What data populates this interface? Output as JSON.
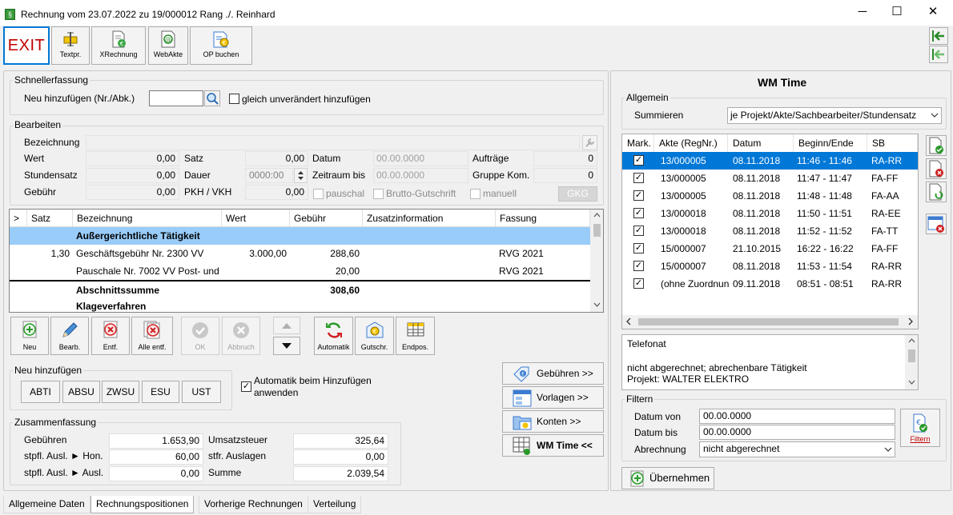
{
  "window": {
    "title": "Rechnung vom 23.07.2022 zu 19/000012  Rang ./. Reinhard",
    "minimize": "─",
    "maximize": "☐",
    "close": "✕"
  },
  "toolbar": {
    "exit": "EXIT",
    "textpr": "Textpr.",
    "xrechnung": "XRechnung",
    "webakte": "WebAkte",
    "op_buchen": "OP buchen"
  },
  "schnell": {
    "group": "Schnellerfassung",
    "label": "Neu hinzufügen (Nr./Abk.)",
    "value": "",
    "checkbox": "gleich unverändert hinzufügen"
  },
  "bearbeiten": {
    "group": "Bearbeiten",
    "bezeichnung_label": "Bezeichnung",
    "bezeichnung": "",
    "wert_label": "Wert",
    "wert": "0,00",
    "stundensatz_label": "Stundensatz",
    "stundensatz": "0,00",
    "gebuehr_label": "Gebühr",
    "gebuehr": "0,00",
    "satz_label": "Satz",
    "satz": "0,00",
    "dauer_label": "Dauer",
    "dauer": "0000:00",
    "pkh_label": "PKH / VKH",
    "pkh": "0,00",
    "datum_label": "Datum",
    "datum": "00.00.0000",
    "zeitraum_label": "Zeitraum bis",
    "zeitraum": "00.00.0000",
    "pauschal": "pauschal",
    "brutto": "Brutto-Gutschrift",
    "manuell": "manuell",
    "auftraege_label": "Aufträge",
    "auftraege": "0",
    "gruppe_label": "Gruppe Kom.",
    "gruppe": "0",
    "gkg": "GKG"
  },
  "table": {
    "headers": [
      ">",
      "Satz",
      "Bezeichnung",
      "Wert",
      "Gebühr",
      "Zusatzinformation",
      "Fassung"
    ],
    "rows": [
      {
        "satz": "",
        "bez": "Außergerichtliche Tätigkeit",
        "wert": "",
        "geb": "",
        "zusatz": "",
        "fassung": "",
        "bold": true,
        "selected": true
      },
      {
        "satz": "1,30",
        "bez": "Geschäftsgebühr Nr. 2300 VV",
        "wert": "3.000,00",
        "geb": "288,60",
        "zusatz": "",
        "fassung": "RVG 2021",
        "bold": false,
        "selected": false
      },
      {
        "satz": "",
        "bez": "Pauschale Nr. 7002 VV Post- und",
        "wert": "",
        "geb": "20,00",
        "zusatz": "",
        "fassung": "RVG 2021",
        "bold": false,
        "selected": false
      },
      {
        "satz": "",
        "bez": "Abschnittssumme",
        "wert": "",
        "geb": "308,60",
        "zusatz": "",
        "fassung": "",
        "bold": true,
        "selected": false
      },
      {
        "satz": "",
        "bez": "Klageverfahren",
        "wert": "",
        "geb": "",
        "zusatz": "",
        "fassung": "",
        "bold": true,
        "selected": false
      }
    ]
  },
  "actions": {
    "neu": "Neu",
    "bearb": "Bearb.",
    "entf": "Entf.",
    "alle_entf": "Alle entf.",
    "ok": "OK",
    "abbruch": "Abbruch",
    "automatik": "Automatik",
    "gutschr": "Gutschr.",
    "endpos": "Endpos."
  },
  "neu_hinzufuegen": {
    "group": "Neu hinzufügen",
    "buttons": [
      "ABTI",
      "ABSU",
      "ZWSU",
      "ESU",
      "UST"
    ],
    "auto": "Automatik beim Hinzufügen anwenden"
  },
  "side_buttons": {
    "gebuehren": "Gebühren >>",
    "vorlagen": "Vorlagen >>",
    "konten": "Konten >>",
    "wmtime": "WM Time <<"
  },
  "zusammenfassung": {
    "group": "Zusammenfassung",
    "gebuehren_label": "Gebühren",
    "gebuehren": "1.653,90",
    "hon_label": "stpfl. Ausl. ► Hon.",
    "hon": "60,00",
    "ausl_label": "stpfl. Ausl. ► Ausl.",
    "ausl": "0,00",
    "ust_label": "Umsatzsteuer",
    "ust": "325,64",
    "stfr_label": "stfr. Auslagen",
    "stfr": "0,00",
    "summe_label": "Summe",
    "summe": "2.039,54"
  },
  "tabs": [
    "Allgemeine Daten",
    "Rechnungspositionen",
    "Vorherige Rechnungen",
    "Verteilung"
  ],
  "wm": {
    "title": "WM Time",
    "allgemein": "Allgemein",
    "summieren_label": "Summieren",
    "summieren": "je Projekt/Akte/Sachbearbeiter/Stundensatz",
    "headers": [
      "Mark.",
      "Akte (RegNr.)",
      "Datum",
      "Beginn/Ende",
      "SB"
    ],
    "rows": [
      {
        "akte": "13/000005",
        "datum": "08.11.2018",
        "zeit": "11:46 - 11:46",
        "sb": "RA-RR",
        "selected": true
      },
      {
        "akte": "13/000005",
        "datum": "08.11.2018",
        "zeit": "11:47 - 11:47",
        "sb": "FA-FF",
        "selected": false
      },
      {
        "akte": "13/000005",
        "datum": "08.11.2018",
        "zeit": "11:48 - 11:48",
        "sb": "FA-AA",
        "selected": false
      },
      {
        "akte": "13/000018",
        "datum": "08.11.2018",
        "zeit": "11:50 - 11:51",
        "sb": "RA-EE",
        "selected": false
      },
      {
        "akte": "13/000018",
        "datum": "08.11.2018",
        "zeit": "11:52 - 11:52",
        "sb": "FA-TT",
        "selected": false
      },
      {
        "akte": "15/000007",
        "datum": "21.10.2015",
        "zeit": "16:22 - 16:22",
        "sb": "FA-FF",
        "selected": false
      },
      {
        "akte": "15/000007",
        "datum": "08.11.2018",
        "zeit": "11:53 - 11:54",
        "sb": "RA-RR",
        "selected": false
      },
      {
        "akte": "(ohne Zuordnung)",
        "datum": "09.11.2018",
        "zeit": "08:51 - 08:51",
        "sb": "RA-RR",
        "selected": false
      }
    ],
    "memo_line1": "Telefonat",
    "memo_line2": "nicht abgerechnet; abrechenbare Tätigkeit",
    "memo_line3": "Projekt: WALTER ELEKTRO",
    "filtern": "Filtern",
    "datum_von_label": "Datum von",
    "datum_von": "00.00.0000",
    "datum_bis_label": "Datum bis",
    "datum_bis": "00.00.0000",
    "abrechnung_label": "Abrechnung",
    "abrechnung": "nicht abgerechnet",
    "filtern_btn": "Filtern",
    "uebernehmen": "Übernehmen"
  }
}
